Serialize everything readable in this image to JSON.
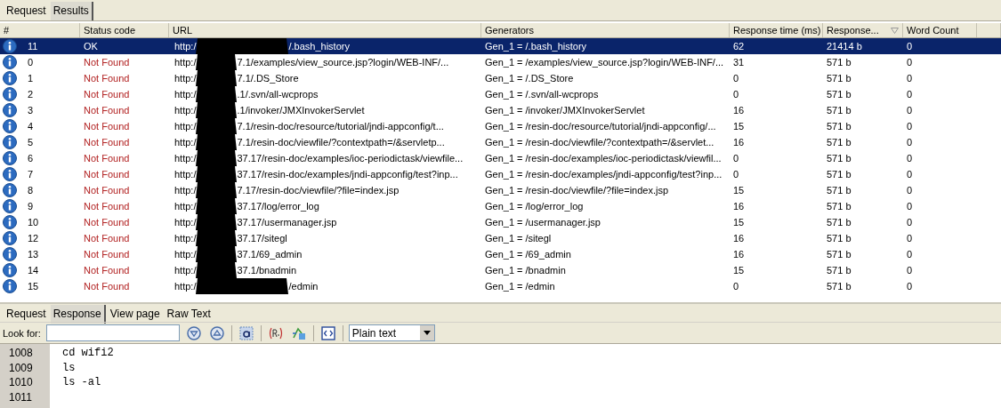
{
  "top_tabs": [
    {
      "label": "Request",
      "selected": false
    },
    {
      "label": "Results",
      "selected": true
    }
  ],
  "table": {
    "columns": [
      {
        "label": "#",
        "sorted": false
      },
      {
        "label": "Status code",
        "sorted": false
      },
      {
        "label": "URL",
        "sorted": false
      },
      {
        "label": "Generators",
        "sorted": false
      },
      {
        "label": "Response time (ms)",
        "sorted": false
      },
      {
        "label": "Response...",
        "sorted": true
      },
      {
        "label": "Word Count",
        "sorted": false
      }
    ],
    "rows": [
      {
        "num": "11",
        "status": "OK",
        "ok": true,
        "selected": true,
        "url": {
          "scheme": "http:/",
          "path": "/.bash_history"
        },
        "generator": "Gen_1 = /.bash_history",
        "time": "62",
        "size": "21414 b",
        "words": "0"
      },
      {
        "num": "0",
        "status": "Not Found",
        "ok": false,
        "selected": false,
        "url": {
          "scheme": "http:/",
          "host_tail": "7.1",
          "path": "/examples/view_source.jsp?login/WEB-INF/..."
        },
        "generator": "Gen_1 = /examples/view_source.jsp?login/WEB-INF/...",
        "time": "31",
        "size": "571 b",
        "words": "0"
      },
      {
        "num": "1",
        "status": "Not Found",
        "ok": false,
        "selected": false,
        "url": {
          "scheme": "http:/",
          "host_tail": "7.1",
          "path": "/.DS_Store"
        },
        "generator": "Gen_1 = /.DS_Store",
        "time": "0",
        "size": "571 b",
        "words": "0"
      },
      {
        "num": "2",
        "status": "Not Found",
        "ok": false,
        "selected": false,
        "url": {
          "scheme": "http:/",
          "host_tail": ".1",
          "path": "/.svn/all-wcprops"
        },
        "generator": "Gen_1 = /.svn/all-wcprops",
        "time": "0",
        "size": "571 b",
        "words": "0"
      },
      {
        "num": "3",
        "status": "Not Found",
        "ok": false,
        "selected": false,
        "url": {
          "scheme": "http:/",
          "host_tail": ".1",
          "path": "/invoker/JMXInvokerServlet"
        },
        "generator": "Gen_1 = /invoker/JMXInvokerServlet",
        "time": "16",
        "size": "571 b",
        "words": "0"
      },
      {
        "num": "4",
        "status": "Not Found",
        "ok": false,
        "selected": false,
        "url": {
          "scheme": "http:/",
          "host_tail": "7.1",
          "path": "/resin-doc/resource/tutorial/jndi-appconfig/t..."
        },
        "generator": "Gen_1 = /resin-doc/resource/tutorial/jndi-appconfig/...",
        "time": "15",
        "size": "571 b",
        "words": "0"
      },
      {
        "num": "5",
        "status": "Not Found",
        "ok": false,
        "selected": false,
        "url": {
          "scheme": "http:/",
          "host_tail": "7.1",
          "path": "/resin-doc/viewfile/?contextpath=/&servletp..."
        },
        "generator": "Gen_1 = /resin-doc/viewfile/?contextpath=/&servlet...",
        "time": "16",
        "size": "571 b",
        "words": "0"
      },
      {
        "num": "6",
        "status": "Not Found",
        "ok": false,
        "selected": false,
        "url": {
          "scheme": "http:/",
          "host_tail": "37.17",
          "path": "/resin-doc/examples/ioc-periodictask/viewfile..."
        },
        "generator": "Gen_1 = /resin-doc/examples/ioc-periodictask/viewfil...",
        "time": "0",
        "size": "571 b",
        "words": "0"
      },
      {
        "num": "7",
        "status": "Not Found",
        "ok": false,
        "selected": false,
        "url": {
          "scheme": "http:/",
          "host_tail": "37.17",
          "path": "/resin-doc/examples/jndi-appconfig/test?inp..."
        },
        "generator": "Gen_1 = /resin-doc/examples/jndi-appconfig/test?inp...",
        "time": "0",
        "size": "571 b",
        "words": "0"
      },
      {
        "num": "8",
        "status": "Not Found",
        "ok": false,
        "selected": false,
        "url": {
          "scheme": "http:/",
          "host_tail": "7.17",
          "path": "/resin-doc/viewfile/?file=index.jsp"
        },
        "generator": "Gen_1 = /resin-doc/viewfile/?file=index.jsp",
        "time": "15",
        "size": "571 b",
        "words": "0"
      },
      {
        "num": "9",
        "status": "Not Found",
        "ok": false,
        "selected": false,
        "url": {
          "scheme": "http:/",
          "host_tail": "37.17",
          "path": "/log/error_log"
        },
        "generator": "Gen_1 = /log/error_log",
        "time": "16",
        "size": "571 b",
        "words": "0"
      },
      {
        "num": "10",
        "status": "Not Found",
        "ok": false,
        "selected": false,
        "url": {
          "scheme": "http:/",
          "host_tail": "37.17",
          "path": "/usermanager.jsp"
        },
        "generator": "Gen_1 = /usermanager.jsp",
        "time": "15",
        "size": "571 b",
        "words": "0"
      },
      {
        "num": "12",
        "status": "Not Found",
        "ok": false,
        "selected": false,
        "url": {
          "scheme": "http:/",
          "host_tail": "37.17",
          "path": "/sitegl"
        },
        "generator": "Gen_1 = /sitegl",
        "time": "16",
        "size": "571 b",
        "words": "0"
      },
      {
        "num": "13",
        "status": "Not Found",
        "ok": false,
        "selected": false,
        "url": {
          "scheme": "http:/",
          "host_tail": "37.1",
          "path": "/69_admin"
        },
        "generator": "Gen_1 = /69_admin",
        "time": "16",
        "size": "571 b",
        "words": "0"
      },
      {
        "num": "14",
        "status": "Not Found",
        "ok": false,
        "selected": false,
        "url": {
          "scheme": "http:/",
          "host_tail": "37.1",
          "path": "/bnadmin"
        },
        "generator": "Gen_1 = /bnadmin",
        "time": "15",
        "size": "571 b",
        "words": "0"
      },
      {
        "num": "15",
        "status": "Not Found",
        "ok": false,
        "selected": false,
        "url": {
          "scheme": "http:/",
          "path": "/edmin"
        },
        "generator": "Gen_1 = /edmin",
        "time": "0",
        "size": "571 b",
        "words": "0"
      }
    ]
  },
  "bottom_tabs": [
    {
      "label": "Request",
      "selected": false
    },
    {
      "label": "Response",
      "selected": true
    },
    {
      "label": "View page",
      "selected": false
    },
    {
      "label": "Raw Text",
      "selected": false
    }
  ],
  "toolbar": {
    "look_for_label": "Look for:",
    "format": "Plain text"
  },
  "response_lines": [
    {
      "number": "1008",
      "text": "cd wifi2"
    },
    {
      "number": "1009",
      "text": "ls"
    },
    {
      "number": "1010",
      "text": "ls -al"
    },
    {
      "number": "1011"
    }
  ]
}
